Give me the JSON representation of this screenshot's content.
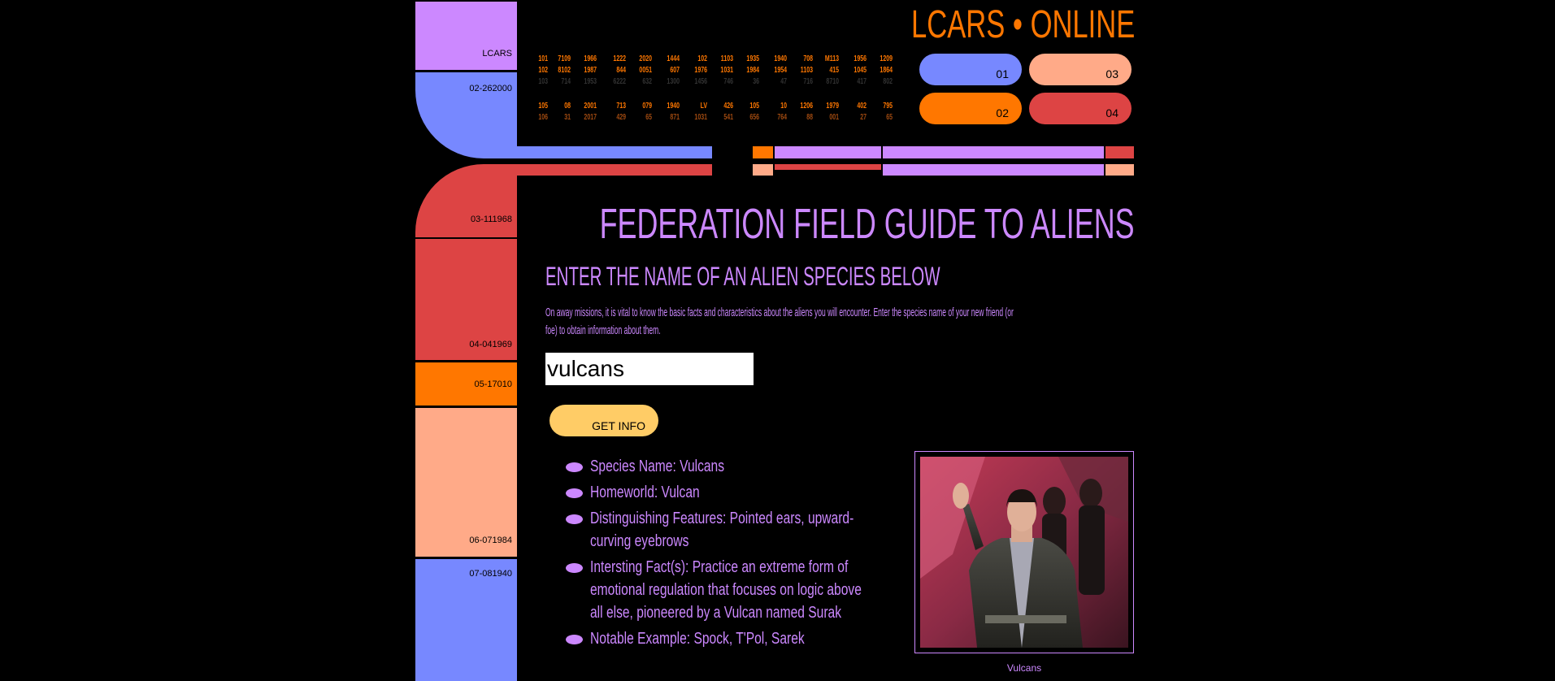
{
  "header": {
    "brand": "LCARS • ONLINE"
  },
  "sidebar_top": {
    "block1_label": "LCARS",
    "block2_label": "02-262000"
  },
  "sidebar_bottom": {
    "labels": [
      "03-111968",
      "04-041969",
      "05-17010",
      "06-071984",
      "07-081940"
    ]
  },
  "number_grid": {
    "row1": [
      [
        "101",
        "102",
        "103"
      ],
      [
        "7109",
        "8102",
        "714"
      ],
      [
        "1966",
        "1987",
        "1953"
      ],
      [
        "1222",
        "844",
        "6222"
      ],
      [
        "2020",
        "0051",
        "632"
      ],
      [
        "1444",
        "607",
        "1300"
      ],
      [
        "102",
        "1976",
        "1456"
      ],
      [
        "1103",
        "1031",
        "746"
      ],
      [
        "1935",
        "1984",
        "36"
      ],
      [
        "1940",
        "1954",
        "47"
      ],
      [
        "708",
        "1103",
        "716"
      ],
      [
        "M113",
        "415",
        "8710"
      ],
      [
        "1956",
        "1045",
        "417"
      ],
      [
        "1209",
        "1864",
        "802"
      ]
    ],
    "row2": [
      [
        "105",
        "106"
      ],
      [
        "08",
        "31"
      ],
      [
        "2001",
        "2017"
      ],
      [
        "713",
        "429"
      ],
      [
        "079",
        "65"
      ],
      [
        "1940",
        "871"
      ],
      [
        "LV",
        "1031"
      ],
      [
        "426",
        "541"
      ],
      [
        "105",
        "656"
      ],
      [
        "10",
        "764"
      ],
      [
        "1206",
        "88"
      ],
      [
        "1979",
        "001"
      ],
      [
        "402",
        "27"
      ],
      [
        "795",
        "65"
      ]
    ]
  },
  "pills": {
    "p01": "01",
    "p02": "02",
    "p03": "03",
    "p04": "04"
  },
  "main": {
    "title": "FEDERATION FIELD GUIDE TO ALIENS",
    "subtitle": "ENTER THE NAME OF AN ALIEN SPECIES BELOW",
    "intro": "On away missions, it is vital to know the basic facts and characteristics about the aliens you will encounter. Enter the species name of your new friend (or foe) to obtain information about them.",
    "search_value": "vulcans",
    "button_label": "GET INFO",
    "facts": [
      "Species Name: Vulcans",
      "Homeworld: Vulcan",
      "Distinguishing Features: Pointed ears, upward-curving eyebrows",
      "Intersting Fact(s): Practice an extreme form of emotional regulation that focuses on logic above all else, pioneered by a Vulcan named Surak",
      "Notable Example: Spock, T'Pol, Sarek"
    ],
    "image_caption": "Vulcans"
  },
  "colors": {
    "orange": "#ff7700",
    "lilac": "#cc88ff",
    "blue": "#7788ff",
    "peach": "#ffaa88",
    "red": "#dd4444",
    "gold": "#ffcc66"
  }
}
